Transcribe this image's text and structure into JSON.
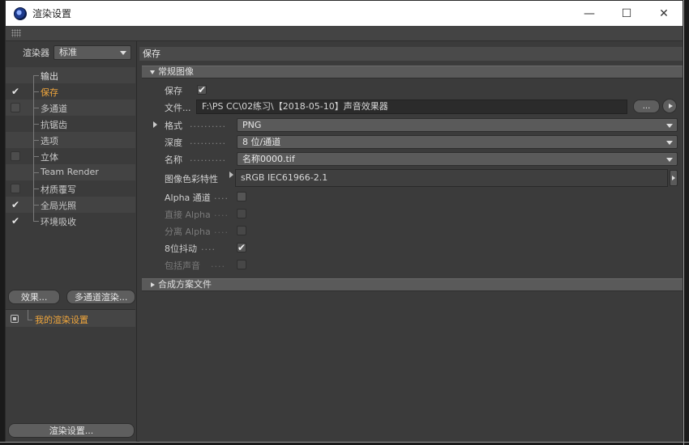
{
  "window": {
    "title": "渲染设置",
    "controls": {
      "minimize": "—",
      "maximize": "☐",
      "close": "✕"
    }
  },
  "left": {
    "renderer_label": "渲染器",
    "renderer_value": "标准",
    "items": [
      {
        "label": "输出",
        "checkbox": "none",
        "checked": false
      },
      {
        "label": "保存",
        "checkbox": "check",
        "checked": true
      },
      {
        "label": "多通道",
        "checkbox": "box",
        "checked": false
      },
      {
        "label": "抗锯齿",
        "checkbox": "none",
        "checked": false
      },
      {
        "label": "选项",
        "checkbox": "none",
        "checked": false
      },
      {
        "label": "立体",
        "checkbox": "box",
        "checked": false
      },
      {
        "label": "Team Render",
        "checkbox": "none",
        "checked": false
      },
      {
        "label": "材质覆写",
        "checkbox": "box",
        "checked": false
      },
      {
        "label": "全局光照",
        "checkbox": "check",
        "checked": true
      },
      {
        "label": "环境吸收",
        "checkbox": "check",
        "checked": true
      }
    ],
    "effects_button": "效果...",
    "multipass_button": "多通道渲染...",
    "preset_label": "我的渲染设置",
    "render_settings_button": "渲染设置..."
  },
  "right": {
    "header": "保存",
    "section_regular": "常规图像",
    "save_label": "保存",
    "save_checked": "✔",
    "file_label": "文件...",
    "file_path": "F:\\PS CC\\02练习\\【2018-05-10】声音效果器",
    "browse_button": "...",
    "format_label": "格式",
    "format_value": "PNG",
    "depth_label": "深度",
    "depth_value": "8 位/通道",
    "name_label": "名称",
    "name_value": "名称0000.tif",
    "color_profile_label": "图像色彩特性",
    "color_profile_value": "sRGB IEC61966-2.1",
    "alpha_label": "Alpha 通道",
    "straight_alpha_label": "直接 Alpha",
    "separate_alpha_label": "分离 Alpha",
    "dither_label": "8位抖动",
    "dither_checked": "✔",
    "sound_label": "包括声音",
    "dots_short": "....",
    "dots_long": "..........",
    "section_compositing": "合成方案文件"
  },
  "colors": {
    "accent": "#f0a63c",
    "window_bg": "#3b3b3b",
    "section_bg": "#5a5a5a"
  }
}
